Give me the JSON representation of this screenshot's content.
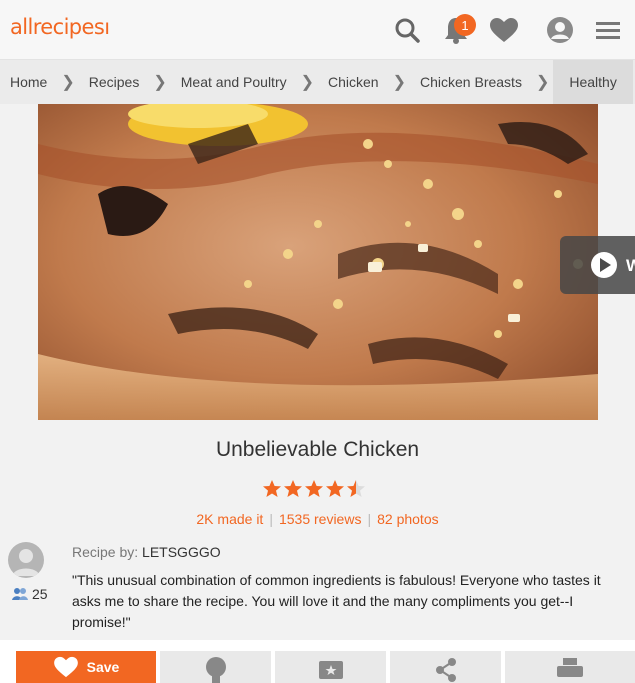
{
  "header": {
    "logo_text": "allrecipes",
    "notification_count": "1",
    "brand_color": "#f26722"
  },
  "breadcrumb": [
    "Home",
    "Recipes",
    "Meat and Poultry",
    "Chicken",
    "Chicken Breasts",
    "Healthy"
  ],
  "recipe": {
    "title": "Unbelievable Chicken",
    "rating": 4.5,
    "made_it": "2K made it",
    "reviews": "1535 reviews",
    "photos": "82 photos",
    "byline_label": "Recipe by:",
    "author": "LETSGGGO",
    "followers": "25",
    "description": "\"This unusual combination of common ingredients is fabulous! Everyone who tastes it asks me to share the recipe. You will love it and the many compliments you get--I promise!\""
  },
  "actions": {
    "save_label": "Save",
    "icons": [
      "heart-icon",
      "lightbulb-icon",
      "star-card-icon",
      "share-icon",
      "print-icon"
    ]
  },
  "video": {
    "icon": "play-icon",
    "label_fragment": "W"
  }
}
